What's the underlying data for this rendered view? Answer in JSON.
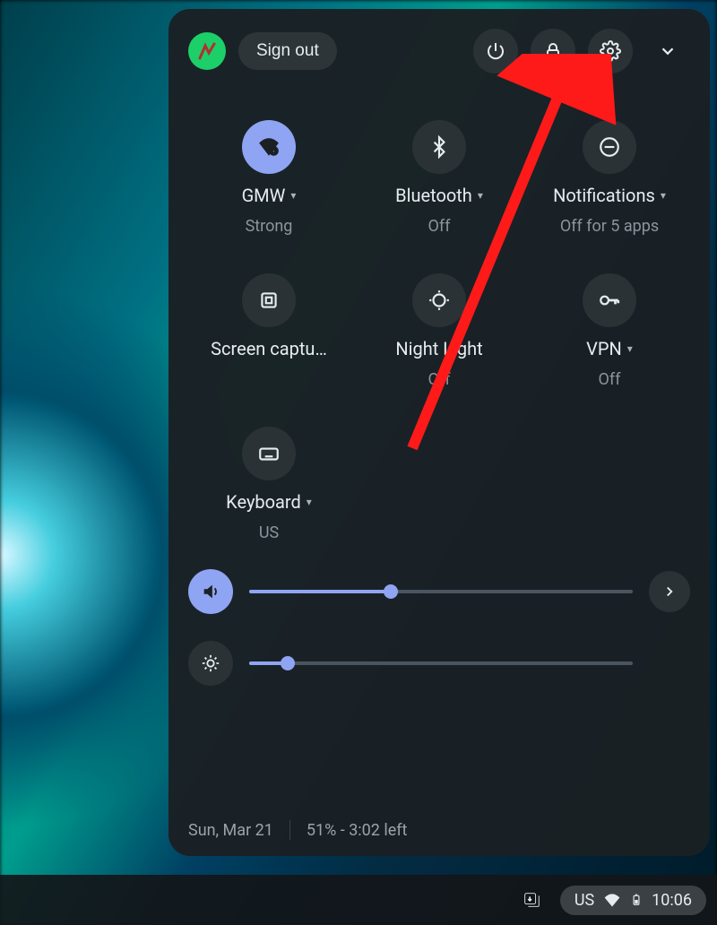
{
  "header": {
    "signout_label": "Sign out"
  },
  "tiles": [
    {
      "label": "GMW",
      "sub": "Strong",
      "has_caret": true
    },
    {
      "label": "Bluetooth",
      "sub": "Off",
      "has_caret": true
    },
    {
      "label": "Notifications",
      "sub": "Off for 5 apps",
      "has_caret": true
    },
    {
      "label": "Screen captu…",
      "sub": "",
      "has_caret": false
    },
    {
      "label": "Night Light",
      "sub": "Off",
      "has_caret": false
    },
    {
      "label": "VPN",
      "sub": "Off",
      "has_caret": true
    },
    {
      "label": "Keyboard",
      "sub": "US",
      "has_caret": true
    }
  ],
  "sliders": {
    "volume_percent": 37,
    "brightness_percent": 10
  },
  "footer": {
    "date": "Sun, Mar 21",
    "battery": "51% - 3:02 left"
  },
  "taskbar": {
    "ime": "US",
    "clock": "10:06"
  }
}
